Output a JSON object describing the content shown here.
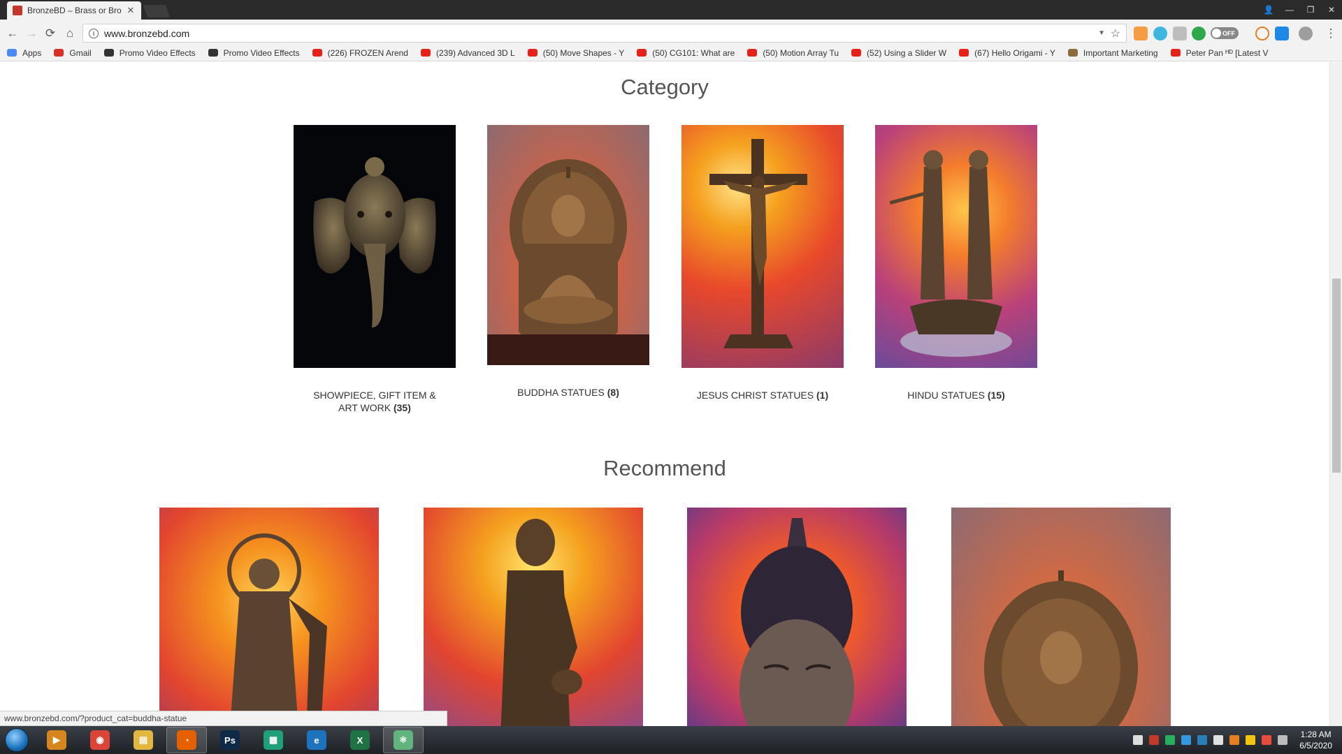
{
  "browser": {
    "tab_title": "BronzeBD – Brass or Bro",
    "tab_close": "✕",
    "window_controls": [
      "👤",
      "—",
      "❐",
      "✕"
    ],
    "url": "www.bronzebd.com",
    "nav": {
      "back": "←",
      "forward": "→",
      "reload": "⟳",
      "home": "⌂"
    },
    "toggle_label": "OFF",
    "bookmarks": [
      {
        "label": "Apps",
        "icon": "apps-grid-icon",
        "color": "#4a8af4"
      },
      {
        "label": "Gmail",
        "icon": "gmail-icon",
        "color": "#d93025"
      },
      {
        "label": "Promo Video Effects",
        "icon": "promo-icon",
        "color": "#333333"
      },
      {
        "label": "Promo Video Effects",
        "icon": "promo-icon",
        "color": "#333333"
      },
      {
        "label": "(226) FROZEN Arend",
        "icon": "youtube-icon",
        "color": "#e62117"
      },
      {
        "label": "(239) Advanced 3D L",
        "icon": "youtube-icon",
        "color": "#e62117"
      },
      {
        "label": "(50) Move Shapes - Y",
        "icon": "youtube-icon",
        "color": "#e62117"
      },
      {
        "label": "(50) CG101: What are",
        "icon": "youtube-icon",
        "color": "#e62117"
      },
      {
        "label": "(50) Motion Array Tu",
        "icon": "youtube-icon",
        "color": "#e62117"
      },
      {
        "label": "(52) Using a Slider W",
        "icon": "youtube-icon",
        "color": "#e62117"
      },
      {
        "label": "(67) Hello Origami - Y",
        "icon": "youtube-icon",
        "color": "#e62117"
      },
      {
        "label": "Important Marketing",
        "icon": "doc-icon",
        "color": "#8a6d3b"
      },
      {
        "label": "Peter Pan ᴴᴰ [Latest V",
        "icon": "youtube-icon",
        "color": "#e62117"
      }
    ]
  },
  "page": {
    "category_title": "Category",
    "categories": [
      {
        "name": "SHOWPIECE, GIFT ITEM & ART WORK",
        "count": "(35)"
      },
      {
        "name": "BUDDHA STATUES",
        "count": "(8)"
      },
      {
        "name": "JESUS CHRIST STATUES",
        "count": "(1)"
      },
      {
        "name": "HINDU STATUES",
        "count": "(15)"
      }
    ],
    "recommend_title": "Recommend"
  },
  "status_url": "www.bronzebd.com/?product_cat=buddha-statue",
  "taskbar": {
    "apps": [
      {
        "name": "media-player",
        "glyph": "▶",
        "color": "#d7861d"
      },
      {
        "name": "chrome",
        "glyph": "◉",
        "color": "#db4437"
      },
      {
        "name": "file-explorer",
        "glyph": "▤",
        "color": "#e3b640"
      },
      {
        "name": "firefox",
        "glyph": "◔",
        "color": "#e66000"
      },
      {
        "name": "photoshop",
        "glyph": "Ps",
        "color": "#0f2a47"
      },
      {
        "name": "documents",
        "glyph": "▦",
        "color": "#1fa07a"
      },
      {
        "name": "internet-explorer",
        "glyph": "e",
        "color": "#1e73be"
      },
      {
        "name": "excel",
        "glyph": "X",
        "color": "#1f7244"
      },
      {
        "name": "atom",
        "glyph": "⚛",
        "color": "#5fb57d"
      }
    ],
    "time": "1:28 AM",
    "date": "6/5/2020"
  }
}
